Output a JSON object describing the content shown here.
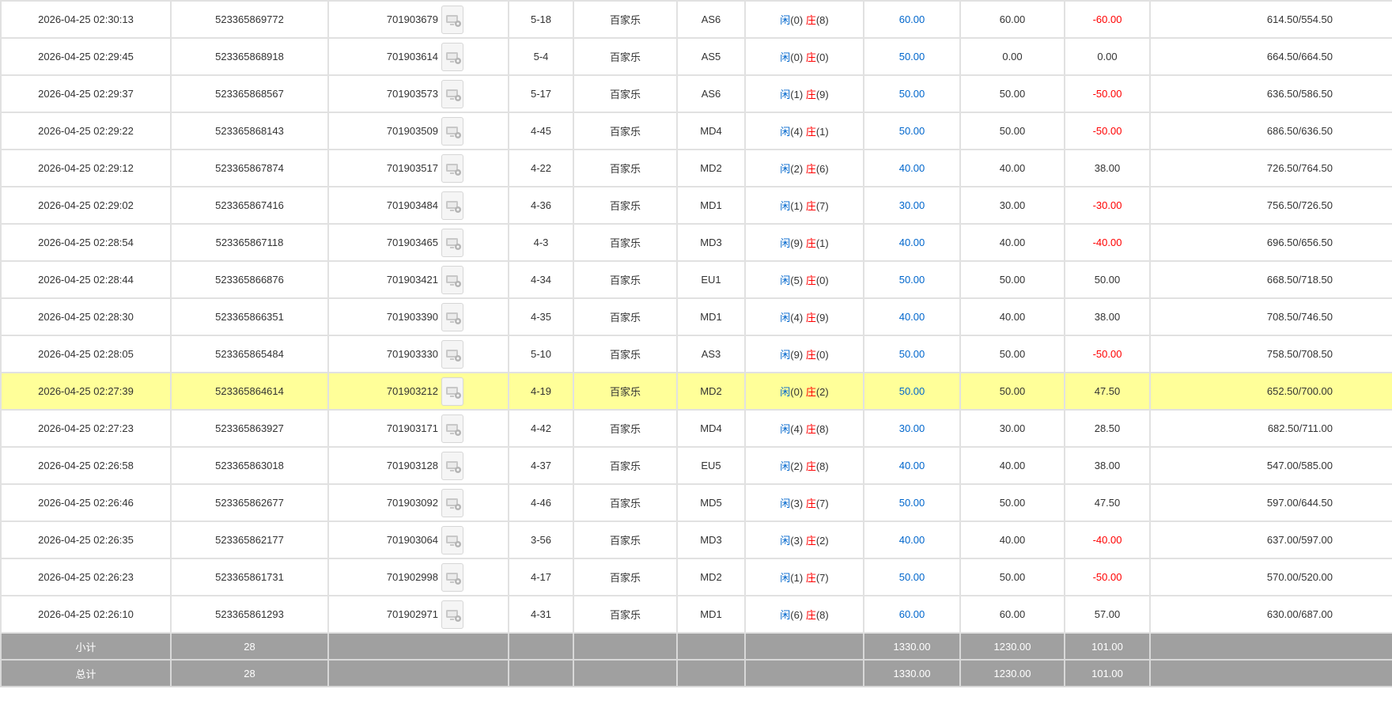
{
  "colors": {
    "blue": "#0066cc",
    "red": "#ff0000",
    "highlight": "#ffff99",
    "summary_bg": "#a0a0a0"
  },
  "icon": "video-replay-icon",
  "rows": [
    {
      "time": "2026-04-25 02:30:13",
      "bet_id": "523365869772",
      "round": "701903679",
      "shoe": "5-18",
      "game": "百家乐",
      "table": "AS6",
      "p_label": "闲",
      "p_score": "(0)",
      "b_label": "庄",
      "b_score": "(8)",
      "bet": "60.00",
      "valid": "60.00",
      "win": "-60.00",
      "win_color": "red",
      "balance": "614.50/554.50",
      "highlight": false
    },
    {
      "time": "2026-04-25 02:29:45",
      "bet_id": "523365868918",
      "round": "701903614",
      "shoe": "5-4",
      "game": "百家乐",
      "table": "AS5",
      "p_label": "闲",
      "p_score": "(0)",
      "b_label": "庄",
      "b_score": "(0)",
      "bet": "50.00",
      "valid": "0.00",
      "win": "0.00",
      "win_color": "",
      "balance": "664.50/664.50",
      "highlight": false
    },
    {
      "time": "2026-04-25 02:29:37",
      "bet_id": "523365868567",
      "round": "701903573",
      "shoe": "5-17",
      "game": "百家乐",
      "table": "AS6",
      "p_label": "闲",
      "p_score": "(1)",
      "b_label": "庄",
      "b_score": "(9)",
      "bet": "50.00",
      "valid": "50.00",
      "win": "-50.00",
      "win_color": "red",
      "balance": "636.50/586.50",
      "highlight": false
    },
    {
      "time": "2026-04-25 02:29:22",
      "bet_id": "523365868143",
      "round": "701903509",
      "shoe": "4-45",
      "game": "百家乐",
      "table": "MD4",
      "p_label": "闲",
      "p_score": "(4)",
      "b_label": "庄",
      "b_score": "(1)",
      "bet": "50.00",
      "valid": "50.00",
      "win": "-50.00",
      "win_color": "red",
      "balance": "686.50/636.50",
      "highlight": false
    },
    {
      "time": "2026-04-25 02:29:12",
      "bet_id": "523365867874",
      "round": "701903517",
      "shoe": "4-22",
      "game": "百家乐",
      "table": "MD2",
      "p_label": "闲",
      "p_score": "(2)",
      "b_label": "庄",
      "b_score": "(6)",
      "bet": "40.00",
      "valid": "40.00",
      "win": "38.00",
      "win_color": "",
      "balance": "726.50/764.50",
      "highlight": false
    },
    {
      "time": "2026-04-25 02:29:02",
      "bet_id": "523365867416",
      "round": "701903484",
      "shoe": "4-36",
      "game": "百家乐",
      "table": "MD1",
      "p_label": "闲",
      "p_score": "(1)",
      "b_label": "庄",
      "b_score": "(7)",
      "bet": "30.00",
      "valid": "30.00",
      "win": "-30.00",
      "win_color": "red",
      "balance": "756.50/726.50",
      "highlight": false
    },
    {
      "time": "2026-04-25 02:28:54",
      "bet_id": "523365867118",
      "round": "701903465",
      "shoe": "4-3",
      "game": "百家乐",
      "table": "MD3",
      "p_label": "闲",
      "p_score": "(9)",
      "b_label": "庄",
      "b_score": "(1)",
      "bet": "40.00",
      "valid": "40.00",
      "win": "-40.00",
      "win_color": "red",
      "balance": "696.50/656.50",
      "highlight": false
    },
    {
      "time": "2026-04-25 02:28:44",
      "bet_id": "523365866876",
      "round": "701903421",
      "shoe": "4-34",
      "game": "百家乐",
      "table": "EU1",
      "p_label": "闲",
      "p_score": "(5)",
      "b_label": "庄",
      "b_score": "(0)",
      "bet": "50.00",
      "valid": "50.00",
      "win": "50.00",
      "win_color": "",
      "balance": "668.50/718.50",
      "highlight": false
    },
    {
      "time": "2026-04-25 02:28:30",
      "bet_id": "523365866351",
      "round": "701903390",
      "shoe": "4-35",
      "game": "百家乐",
      "table": "MD1",
      "p_label": "闲",
      "p_score": "(4)",
      "b_label": "庄",
      "b_score": "(9)",
      "bet": "40.00",
      "valid": "40.00",
      "win": "38.00",
      "win_color": "",
      "balance": "708.50/746.50",
      "highlight": false
    },
    {
      "time": "2026-04-25 02:28:05",
      "bet_id": "523365865484",
      "round": "701903330",
      "shoe": "5-10",
      "game": "百家乐",
      "table": "AS3",
      "p_label": "闲",
      "p_score": "(9)",
      "b_label": "庄",
      "b_score": "(0)",
      "bet": "50.00",
      "valid": "50.00",
      "win": "-50.00",
      "win_color": "red",
      "balance": "758.50/708.50",
      "highlight": false
    },
    {
      "time": "2026-04-25 02:27:39",
      "bet_id": "523365864614",
      "round": "701903212",
      "shoe": "4-19",
      "game": "百家乐",
      "table": "MD2",
      "p_label": "闲",
      "p_score": "(0)",
      "b_label": "庄",
      "b_score": "(2)",
      "bet": "50.00",
      "valid": "50.00",
      "win": "47.50",
      "win_color": "",
      "balance": "652.50/700.00",
      "highlight": true
    },
    {
      "time": "2026-04-25 02:27:23",
      "bet_id": "523365863927",
      "round": "701903171",
      "shoe": "4-42",
      "game": "百家乐",
      "table": "MD4",
      "p_label": "闲",
      "p_score": "(4)",
      "b_label": "庄",
      "b_score": "(8)",
      "bet": "30.00",
      "valid": "30.00",
      "win": "28.50",
      "win_color": "",
      "balance": "682.50/711.00",
      "highlight": false
    },
    {
      "time": "2026-04-25 02:26:58",
      "bet_id": "523365863018",
      "round": "701903128",
      "shoe": "4-37",
      "game": "百家乐",
      "table": "EU5",
      "p_label": "闲",
      "p_score": "(2)",
      "b_label": "庄",
      "b_score": "(8)",
      "bet": "40.00",
      "valid": "40.00",
      "win": "38.00",
      "win_color": "",
      "balance": "547.00/585.00",
      "highlight": false
    },
    {
      "time": "2026-04-25 02:26:46",
      "bet_id": "523365862677",
      "round": "701903092",
      "shoe": "4-46",
      "game": "百家乐",
      "table": "MD5",
      "p_label": "闲",
      "p_score": "(3)",
      "b_label": "庄",
      "b_score": "(7)",
      "bet": "50.00",
      "valid": "50.00",
      "win": "47.50",
      "win_color": "",
      "balance": "597.00/644.50",
      "highlight": false
    },
    {
      "time": "2026-04-25 02:26:35",
      "bet_id": "523365862177",
      "round": "701903064",
      "shoe": "3-56",
      "game": "百家乐",
      "table": "MD3",
      "p_label": "闲",
      "p_score": "(3)",
      "b_label": "庄",
      "b_score": "(2)",
      "bet": "40.00",
      "valid": "40.00",
      "win": "-40.00",
      "win_color": "red",
      "balance": "637.00/597.00",
      "highlight": false
    },
    {
      "time": "2026-04-25 02:26:23",
      "bet_id": "523365861731",
      "round": "701902998",
      "shoe": "4-17",
      "game": "百家乐",
      "table": "MD2",
      "p_label": "闲",
      "p_score": "(1)",
      "b_label": "庄",
      "b_score": "(7)",
      "bet": "50.00",
      "valid": "50.00",
      "win": "-50.00",
      "win_color": "red",
      "balance": "570.00/520.00",
      "highlight": false
    },
    {
      "time": "2026-04-25 02:26:10",
      "bet_id": "523365861293",
      "round": "701902971",
      "shoe": "4-31",
      "game": "百家乐",
      "table": "MD1",
      "p_label": "闲",
      "p_score": "(6)",
      "b_label": "庄",
      "b_score": "(8)",
      "bet": "60.00",
      "valid": "60.00",
      "win": "57.00",
      "win_color": "",
      "balance": "630.00/687.00",
      "highlight": false
    }
  ],
  "summary": [
    {
      "label": "小计",
      "count": "28",
      "bet": "1330.00",
      "valid": "1230.00",
      "win": "101.00"
    },
    {
      "label": "总计",
      "count": "28",
      "bet": "1330.00",
      "valid": "1230.00",
      "win": "101.00"
    }
  ]
}
